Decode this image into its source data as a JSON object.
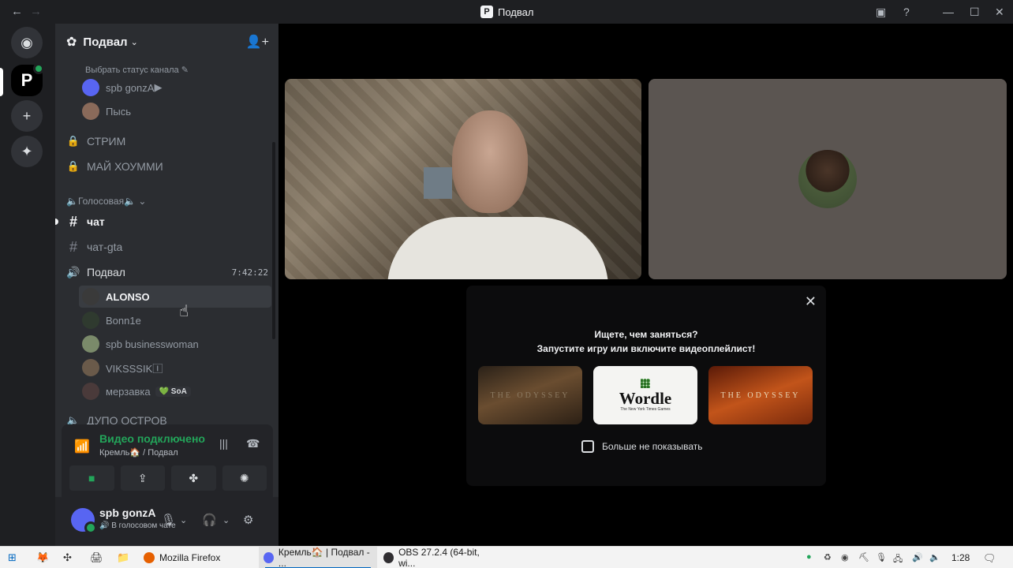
{
  "window": {
    "title": "Подвал",
    "logo": "P",
    "back": "←",
    "forward": "→",
    "controls": [
      "inbox-icon",
      "help-icon",
      "minimize-icon",
      "maximize-icon",
      "close-icon"
    ],
    "control_glyphs": [
      "▣",
      "?",
      "—",
      "☐",
      "✕"
    ]
  },
  "rail": {
    "home_glyph": "◉",
    "server_glyph": "P",
    "add_glyph": "+",
    "explore_glyph": "✦"
  },
  "guild": {
    "name": "Подвал",
    "chevron": "⌄",
    "gear": "✿",
    "invite": "👤+"
  },
  "channels": {
    "status_prompt": "Выбрать статус канала ✎",
    "top_users": [
      {
        "name": "spb gonzA",
        "avatar_color": "#5865f2"
      },
      {
        "name": "Пысь",
        "avatar_color": "#8a6a5a"
      }
    ],
    "locked": [
      {
        "name": "СТРИМ"
      },
      {
        "name": "МАЙ ХОУММИ"
      }
    ],
    "lock_glyph": "🔒",
    "category": "🔈Голосовая🔈 ⌄",
    "text": [
      {
        "name": "чат",
        "unread": true
      },
      {
        "name": "чат-gta",
        "unread": false
      }
    ],
    "hash": "#",
    "voice_channel": {
      "name": "Подвал",
      "time": "7:42:22",
      "speaker": "🔊"
    },
    "voice_users": [
      {
        "name": "ALONSO",
        "avatar_color": "#3a3a3a"
      },
      {
        "name": "Bonn1e",
        "avatar_color": "#2f3a2f"
      },
      {
        "name": "spb businesswoman",
        "avatar_color": "#7a8a6a"
      },
      {
        "name": "VIKSSSIK🄸",
        "avatar_color": "#6a5a4a"
      },
      {
        "name": "мерзавка",
        "avatar_color": "#4a3a3a",
        "badge": "💚 SoA"
      }
    ],
    "cut_off": "ДУПО ОСТРОВ"
  },
  "voice_panel": {
    "title": "Видео подключено",
    "subtitle": "Кремль🏠 / Подвал",
    "signal": "📶",
    "noise": "|||",
    "disconnect": "☎",
    "buttons": [
      {
        "name": "video",
        "glyph": "■"
      },
      {
        "name": "screen-share",
        "glyph": "⇪"
      },
      {
        "name": "activities",
        "glyph": "✤"
      },
      {
        "name": "soundboard",
        "glyph": "✺"
      }
    ]
  },
  "user_panel": {
    "name": "spb gonzA",
    "status": "🔊 В голосовом чате",
    "mic": "🎙",
    "headset": "🎧",
    "chevron": "⌄",
    "settings": "⚙"
  },
  "popup": {
    "close": "✕",
    "line1": "Ищете, чем заняться?",
    "line2": "Запустите игру или включите видеоплейлист!",
    "activities": [
      {
        "kind": "odyssey",
        "title": "THE ODYSSEY"
      },
      {
        "kind": "wordle",
        "title": "Wordle",
        "sub": "The New York Times Games"
      },
      {
        "kind": "odyssey",
        "title": "THE ODYSSEY"
      }
    ],
    "checkbox_label": "Больше не показывать"
  },
  "taskbar": {
    "start": "⊞",
    "icons": [
      "🦊",
      "✣",
      "🖨",
      "📁"
    ],
    "apps": [
      {
        "label": "Mozilla Firefox",
        "color": "#e66000",
        "active": false
      },
      {
        "label": "Кремль🏠 | Подвал - ...",
        "color": "#5865f2",
        "active": true
      },
      {
        "label": "OBS 27.2.4 (64-bit, wi...",
        "color": "#302e31",
        "active": false
      }
    ],
    "tray": [
      "●",
      "♻",
      "◉",
      "⛏",
      "🎙",
      "🖧",
      "🔊",
      "🔈"
    ],
    "clock": "1:28",
    "notifications": "🗨"
  }
}
